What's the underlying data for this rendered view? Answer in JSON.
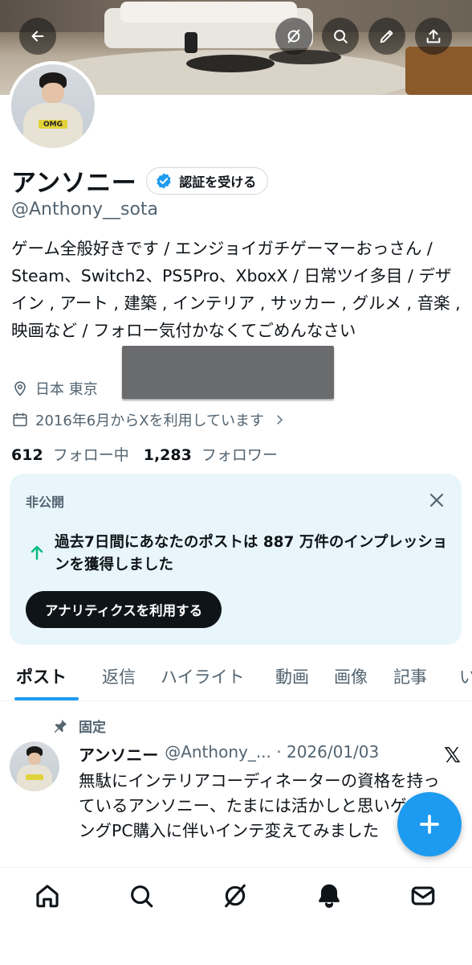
{
  "profile": {
    "name": "アンソニー",
    "verify_label": "認証を受ける",
    "handle": "@Anthony__sota",
    "bio": "ゲーム全般好きです / エンジョイガチゲーマーおっさん / Steam、Switch2、PS5Pro、XboxX / 日常ツイ多目 / デザイン , アート , 建築 , インテリア , サッカー , グルメ , 音楽 , 映画など / フォロー気付かなくてごめんなさい",
    "location": "日本 東京",
    "joined": "2016年6月からXを利用しています",
    "following_count": "612",
    "following_label": "フォロー中",
    "followers_count": "1,283",
    "followers_label": "フォロワー",
    "avatar_sign_text": "OMG"
  },
  "header_icons": [
    "back-arrow-icon",
    "grok-icon",
    "search-icon",
    "edit-pencil-icon",
    "share-icon"
  ],
  "private_card": {
    "label": "非公開",
    "message": "過去7日間にあなたのポストは 887 万件のインプレッションを獲得しました",
    "cta": "アナリティクスを利用する"
  },
  "tabs": [
    {
      "label": "ポスト",
      "active": true
    },
    {
      "label": "返信"
    },
    {
      "label": "ハイライト"
    },
    {
      "label": "動画"
    },
    {
      "label": "画像"
    },
    {
      "label": "記事"
    },
    {
      "label": "い"
    }
  ],
  "pinned_post": {
    "pinned_label": "固定",
    "author_name": "アンソニー",
    "author_handle_date": "@Anthony_... · 2026/01/03",
    "text": "無駄にインテリアコーディネーターの資格を持っているアンソニー、たまには活かしと思いゲーミングPC購入に伴いインテ変えてみました"
  },
  "bottom_nav": [
    "home-icon",
    "search-icon",
    "grok-icon",
    "notifications-bell-icon",
    "messages-icon"
  ],
  "colors": {
    "accent": "#1d9bf0",
    "text": "#0f1419",
    "secondary": "#536471",
    "card_bg": "#e8f6fb",
    "up_arrow": "#00ba7c"
  }
}
